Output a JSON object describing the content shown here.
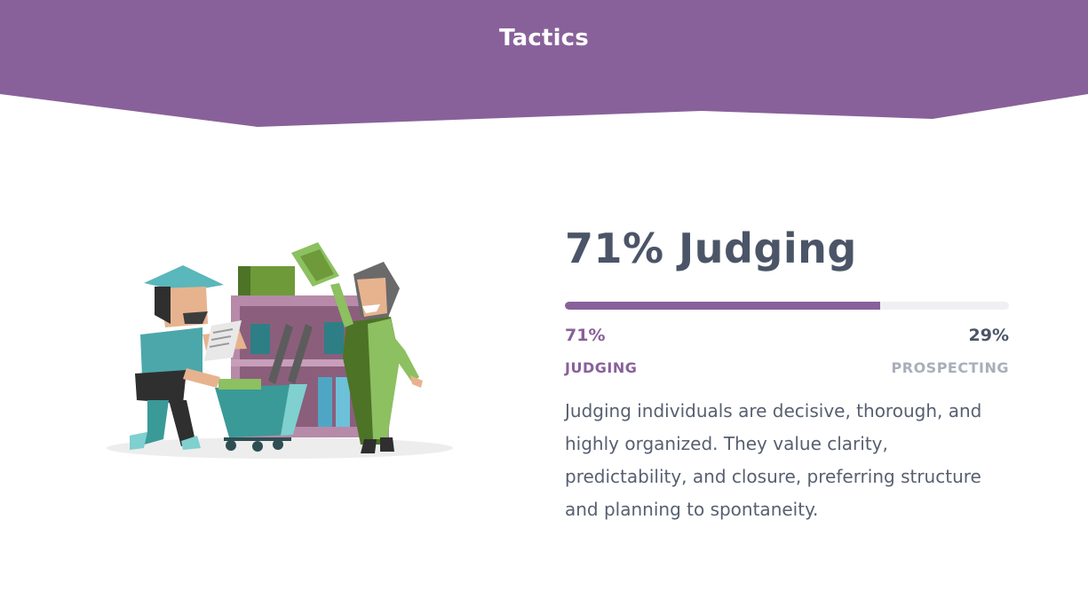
{
  "header": {
    "title": "Tactics"
  },
  "trait": {
    "heading": "71% Judging",
    "fraction": 0.71,
    "left": {
      "percent_text": "71%",
      "label": "JUDGING"
    },
    "right": {
      "percent_text": "29%",
      "label": "PROSPECTING"
    },
    "description": "Judging individuals are decisive, thorough, and highly organized. They value clarity, predictability, and closure, preferring structure and planning to spontaneity."
  },
  "illustration": {
    "name": "judging-shoppers-illustration"
  },
  "colors": {
    "accent": "#88619a",
    "header_bg": "#88619a",
    "heading_text": "#4b5567",
    "body_text": "#576071",
    "muted_label": "#a9aeb9",
    "right_pct": "#4b5567",
    "track": "#f0f0f3"
  }
}
